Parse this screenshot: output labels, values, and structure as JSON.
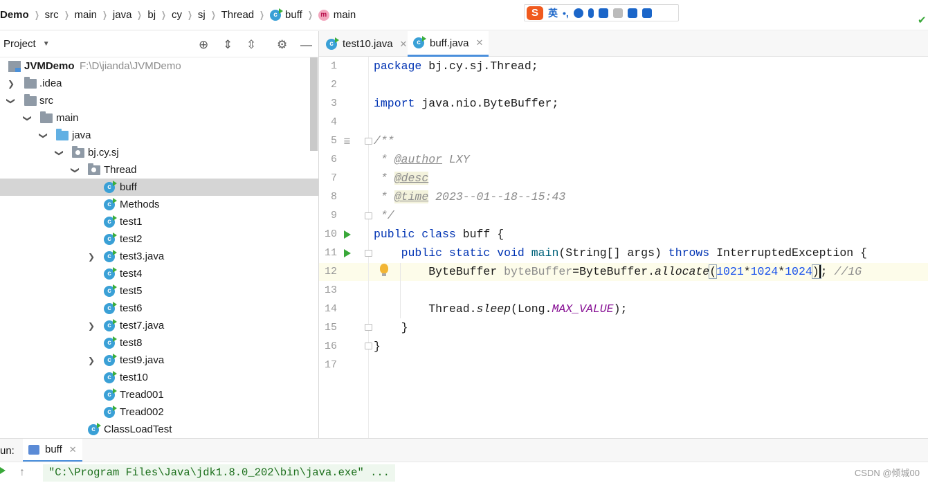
{
  "breadcrumbs": [
    "Demo",
    "src",
    "main",
    "java",
    "bj",
    "cy",
    "sj",
    "Thread",
    "buff",
    "main"
  ],
  "ime": {
    "logo": "S",
    "lang": "英",
    "punct": "•,"
  },
  "project_panel": {
    "title": "Project"
  },
  "tree": [
    {
      "label": "JVMDemo",
      "path": "F:\\D\\jianda\\JVMDemo"
    },
    {
      "label": ".idea"
    },
    {
      "label": "src"
    },
    {
      "label": "main"
    },
    {
      "label": "java"
    },
    {
      "label": "bj.cy.sj"
    },
    {
      "label": "Thread"
    },
    {
      "label": "buff"
    },
    {
      "label": "Methods"
    },
    {
      "label": "test1"
    },
    {
      "label": "test2"
    },
    {
      "label": "test3.java"
    },
    {
      "label": "test4"
    },
    {
      "label": "test5"
    },
    {
      "label": "test6"
    },
    {
      "label": "test7.java"
    },
    {
      "label": "test8"
    },
    {
      "label": "test9.java"
    },
    {
      "label": "test10"
    },
    {
      "label": "Tread001"
    },
    {
      "label": "Tread002"
    },
    {
      "label": "ClassLoadTest"
    }
  ],
  "editor_tabs": [
    {
      "label": "test10.java",
      "active": false
    },
    {
      "label": "buff.java",
      "active": true
    }
  ],
  "line_numbers": [
    "1",
    "2",
    "3",
    "4",
    "5",
    "6",
    "7",
    "8",
    "9",
    "10",
    "11",
    "12",
    "13",
    "14",
    "15",
    "16",
    "17"
  ],
  "code": {
    "l1_kw": "package",
    "l1_rest": " bj.cy.sj.Thread;",
    "l3_kw": "import",
    "l3_rest": " java.nio.ByteBuffer;",
    "l5": "/**",
    "l6_pre": " * ",
    "l6_tag": "@author",
    "l6_val": " LXY",
    "l7_pre": " * ",
    "l7_tag": "@desc",
    "l8_pre": " * ",
    "l8_tag": "@time",
    "l8_val": " 2023--01--18--15:43",
    "l9": " */",
    "l10_kw": "public class",
    "l10_rest": " buff {",
    "l11_kw1": "    public static void",
    "l11_fn": " main",
    "l11_mid": "(String[] args) ",
    "l11_kw2": "throws",
    "l11_rest": " InterruptedException {",
    "l12_a": "        ByteBuffer ",
    "l12_var": "byteBuffer",
    "l12_b": "=ByteBuffer.",
    "l12_call": "allocate",
    "l12_p1": "(",
    "l12_n1": "1021",
    "l12_op1": "*",
    "l12_n2": "1024",
    "l12_op2": "*",
    "l12_n3": "1024",
    "l12_p2": ")",
    "l12_semi": "; ",
    "l12_cm": "//1G",
    "l14_a": "        Thread.",
    "l14_call": "sleep",
    "l14_b": "(Long.",
    "l14_const": "MAX_VALUE",
    "l14_c": ");",
    "l15": "    }",
    "l16": "}"
  },
  "run_panel": {
    "label": "un:",
    "tab": "buff"
  },
  "console": {
    "command": "\"C:\\Program Files\\Java\\jdk1.8.0_202\\bin\\java.exe\" ..."
  },
  "watermark": "CSDN @倾城00",
  "colors": {
    "keyword": "#0033b3",
    "number": "#1750eb",
    "comment": "#8c8c8c",
    "static": "#871094",
    "selection": "#d5d5d5",
    "accent": "#4a8fdc"
  }
}
